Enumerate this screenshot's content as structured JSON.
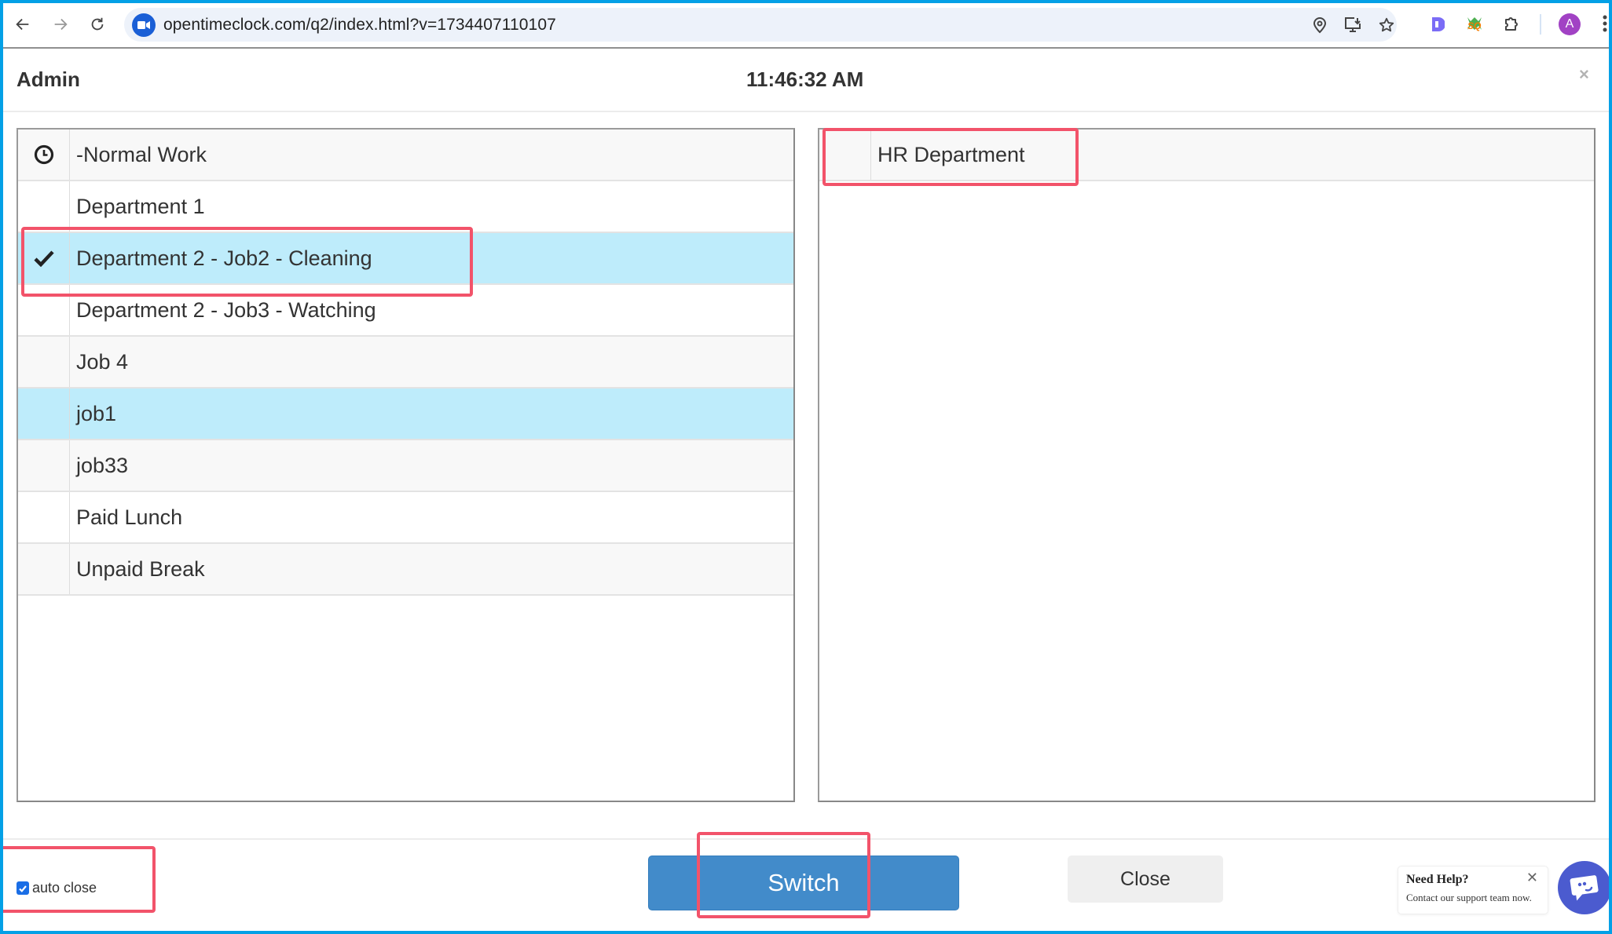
{
  "browser": {
    "url": "opentimeclock.com/q2/index.html?v=1734407110107",
    "profile_initial": "A",
    "icons": [
      "back-icon",
      "forward-icon",
      "reload-icon",
      "site-info-icon",
      "location-icon",
      "install-app-icon",
      "bookmark-star-icon",
      "extension-d-icon",
      "extension-sq-icon",
      "extensions-puzzle-icon",
      "profile-avatar",
      "menu-kebab-icon"
    ]
  },
  "dialog": {
    "title": "Admin",
    "time": "11:46:32 AM",
    "close_symbol": "×"
  },
  "jobs_list": {
    "items": [
      {
        "label": "-Normal Work",
        "icon": "clock-icon",
        "selected": false
      },
      {
        "label": "Department 1",
        "icon": "",
        "selected": false
      },
      {
        "label": "Department 2 - Job2 - Cleaning",
        "icon": "checkmark-icon",
        "selected": true
      },
      {
        "label": "Department 2 - Job3 - Watching",
        "icon": "",
        "selected": false
      },
      {
        "label": "Job 4",
        "icon": "",
        "selected": false
      },
      {
        "label": "job1",
        "icon": "",
        "selected": true
      },
      {
        "label": "job33",
        "icon": "",
        "selected": false
      },
      {
        "label": "Paid Lunch",
        "icon": "",
        "selected": false
      },
      {
        "label": "Unpaid Break",
        "icon": "",
        "selected": false
      }
    ]
  },
  "departments_list": {
    "items": [
      {
        "label": "HR Department",
        "icon": "",
        "selected": false
      }
    ]
  },
  "footer": {
    "auto_close_label": "auto close",
    "auto_close_checked": true,
    "switch_label": "Switch",
    "close_label": "Close"
  },
  "help_widget": {
    "title": "Need Help?",
    "subtitle": "Contact our support team now.",
    "close_symbol": "✕"
  },
  "colors": {
    "frame": "#03a0e6",
    "selected_row": "#beecfb",
    "switch_button": "#428bca",
    "annotation_highlight": "#f2536a",
    "help_fab": "#4b5bcf"
  }
}
